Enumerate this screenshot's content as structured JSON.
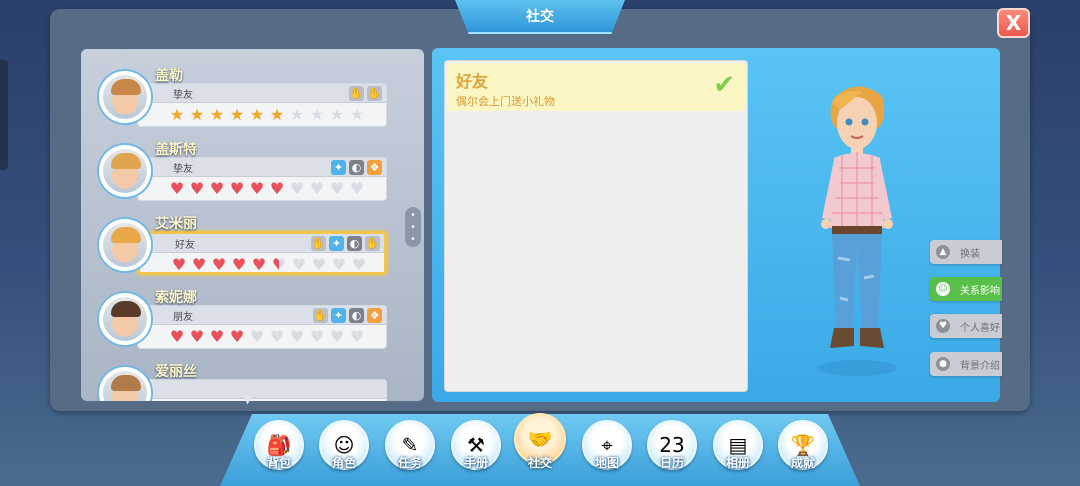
{
  "window": {
    "title": "社交",
    "close_label": "X"
  },
  "characters": [
    {
      "name": "盖勒",
      "relation": "挚友",
      "type": "star",
      "filled": 6,
      "max": 10,
      "icons": [
        "grey",
        "grey"
      ],
      "hair": "#c9884a"
    },
    {
      "name": "盖斯特",
      "relation": "挚友",
      "type": "heart",
      "filled": 6,
      "max": 10,
      "icons": [
        "blue",
        "dark",
        "gift"
      ],
      "hair": "#e0a34e"
    },
    {
      "name": "艾米丽",
      "relation": "好友",
      "type": "heart",
      "filled": 5.5,
      "max": 10,
      "icons": [
        "grey",
        "blue",
        "dark",
        "grey"
      ],
      "hair": "#e8a849"
    },
    {
      "name": "索妮娜",
      "relation": "朋友",
      "type": "heart",
      "filled": 4,
      "max": 10,
      "icons": [
        "grey",
        "blue",
        "dark",
        "gift"
      ],
      "hair": "#5a3b2a"
    },
    {
      "name": "爱丽丝",
      "relation": "",
      "type": "heart",
      "filled": 0,
      "max": 10,
      "icons": [],
      "hair": "#b07a4a"
    }
  ],
  "selected_index": 2,
  "detail": {
    "relation_title": "好友",
    "relation_desc": "偶尔会上门送小礼物"
  },
  "side_buttons": [
    {
      "label": "换装",
      "icon": "shirt-icon",
      "active": false
    },
    {
      "label": "关系影响",
      "icon": "smile-icon",
      "active": true
    },
    {
      "label": "个人喜好",
      "icon": "heart-icon",
      "active": false
    },
    {
      "label": "背景介绍",
      "icon": "person-icon",
      "active": false
    }
  ],
  "nav": [
    {
      "label": "背包",
      "icon": "backpack-icon",
      "glyph": "🎒"
    },
    {
      "label": "角色",
      "icon": "character-icon",
      "glyph": "☺"
    },
    {
      "label": "任务",
      "icon": "task-icon",
      "glyph": "✎"
    },
    {
      "label": "手册",
      "icon": "hammer-icon",
      "glyph": "⚒"
    },
    {
      "label": "社交",
      "icon": "handshake-icon",
      "glyph": "🤝",
      "active": true
    },
    {
      "label": "地图",
      "icon": "map-icon",
      "glyph": "⌖"
    },
    {
      "label": "日历",
      "icon": "calendar-icon",
      "glyph": "23"
    },
    {
      "label": "相册",
      "icon": "album-icon",
      "glyph": "▤"
    },
    {
      "label": "成就",
      "icon": "trophy-icon",
      "glyph": "🏆"
    }
  ]
}
